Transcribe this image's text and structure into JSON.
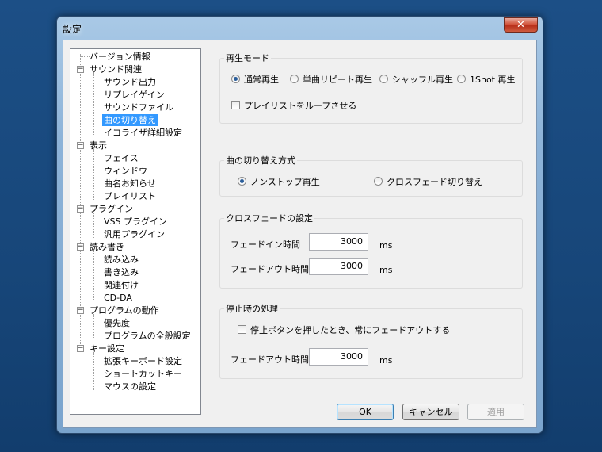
{
  "window": {
    "title": "設定",
    "close_glyph": "✕"
  },
  "tree": {
    "items": [
      {
        "label": "バージョン情報"
      },
      {
        "label": "サウンド関連",
        "expander": "−"
      },
      {
        "label": "サウンド出力"
      },
      {
        "label": "リプレイゲイン"
      },
      {
        "label": "サウンドファイル"
      },
      {
        "label": "曲の切り替え",
        "selected": true
      },
      {
        "label": "イコライザ詳細設定"
      },
      {
        "label": "表示",
        "expander": "−"
      },
      {
        "label": "フェイス"
      },
      {
        "label": "ウィンドウ"
      },
      {
        "label": "曲名お知らせ"
      },
      {
        "label": "プレイリスト"
      },
      {
        "label": "プラグイン",
        "expander": "−"
      },
      {
        "label": "VSS プラグイン"
      },
      {
        "label": "汎用プラグイン"
      },
      {
        "label": "読み書き",
        "expander": "−"
      },
      {
        "label": "読み込み"
      },
      {
        "label": "書き込み"
      },
      {
        "label": "関連付け"
      },
      {
        "label": "CD-DA"
      },
      {
        "label": "プログラムの動作",
        "expander": "−"
      },
      {
        "label": "優先度"
      },
      {
        "label": "プログラムの全般設定"
      },
      {
        "label": "キー設定",
        "expander": "−"
      },
      {
        "label": "拡張キーボード設定"
      },
      {
        "label": "ショートカットキー"
      },
      {
        "label": "マウスの設定"
      }
    ]
  },
  "playback_mode": {
    "label": "再生モード",
    "options": [
      "通常再生",
      "単曲リピート再生",
      "シャッフル再生",
      "1Shot 再生"
    ],
    "selected": "通常再生",
    "loop_playlist_label": "プレイリストをループさせる",
    "loop_playlist_checked": false
  },
  "switch_method": {
    "label": "曲の切り替え方式",
    "options": [
      "ノンストップ再生",
      "クロスフェード切り替え"
    ],
    "selected": "ノンストップ再生"
  },
  "crossfade": {
    "label": "クロスフェードの設定",
    "fade_in_label": "フェードイン時間",
    "fade_in_value": "3000",
    "fade_out_label": "フェードアウト時間",
    "fade_out_value": "3000",
    "unit": "ms"
  },
  "on_stop": {
    "label": "停止時の処理",
    "fade_on_stop_label": "停止ボタンを押したとき、常にフェードアウトする",
    "fade_on_stop_checked": false,
    "fade_out_label": "フェードアウト時間",
    "fade_out_value": "3000",
    "unit": "ms"
  },
  "buttons": {
    "ok": "OK",
    "cancel": "キャンセル",
    "apply": "適用"
  }
}
